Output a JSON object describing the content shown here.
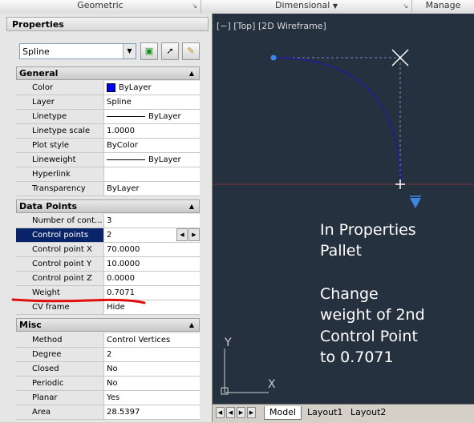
{
  "ribbon": {
    "tabs": [
      {
        "label": "Geometric"
      },
      {
        "label": "Dimensional"
      },
      {
        "label": "Manage"
      }
    ]
  },
  "panel": {
    "title": "Properties",
    "object_type": "Spline",
    "sections": {
      "general": {
        "title": "General",
        "rows": [
          {
            "label": "Color",
            "value": "ByLayer"
          },
          {
            "label": "Layer",
            "value": "Spline"
          },
          {
            "label": "Linetype",
            "value": "ByLayer"
          },
          {
            "label": "Linetype scale",
            "value": "1.0000"
          },
          {
            "label": "Plot style",
            "value": "ByColor"
          },
          {
            "label": "Lineweight",
            "value": "ByLayer"
          },
          {
            "label": "Hyperlink",
            "value": ""
          },
          {
            "label": "Transparency",
            "value": "ByLayer"
          }
        ]
      },
      "data_points": {
        "title": "Data Points",
        "rows": [
          {
            "label": "Number of cont...",
            "value": "3"
          },
          {
            "label": "Control points",
            "value": "2"
          },
          {
            "label": "Control point X",
            "value": "70.0000"
          },
          {
            "label": "Control point Y",
            "value": "10.0000"
          },
          {
            "label": "Control point Z",
            "value": "0.0000"
          },
          {
            "label": "Weight",
            "value": "0.7071"
          },
          {
            "label": "CV frame",
            "value": "Hide"
          }
        ]
      },
      "misc": {
        "title": "Misc",
        "rows": [
          {
            "label": "Method",
            "value": "Control Vertices"
          },
          {
            "label": "Degree",
            "value": "2"
          },
          {
            "label": "Closed",
            "value": "No"
          },
          {
            "label": "Periodic",
            "value": "No"
          },
          {
            "label": "Planar",
            "value": "Yes"
          },
          {
            "label": "Area",
            "value": "28.5397"
          }
        ]
      }
    }
  },
  "viewport": {
    "label": "[−] [Top] [2D Wireframe]",
    "ucs_y": "Y",
    "ucs_x": "X",
    "note_line1": "In Properties",
    "note_line2": "Pallet",
    "note_line3": "Change",
    "note_line4": "weight of 2nd",
    "note_line5": "Control Point",
    "note_line6": "to 0.7071"
  },
  "layout_tabs": [
    {
      "label": "Model"
    },
    {
      "label": "Layout1"
    },
    {
      "label": "Layout2"
    }
  ],
  "colors": {
    "canvas_bg": "#263140",
    "spline": "#1a1aa8",
    "grip": "#3d86e6",
    "selected_row": "#0a246a",
    "annotation": "#e01010"
  }
}
